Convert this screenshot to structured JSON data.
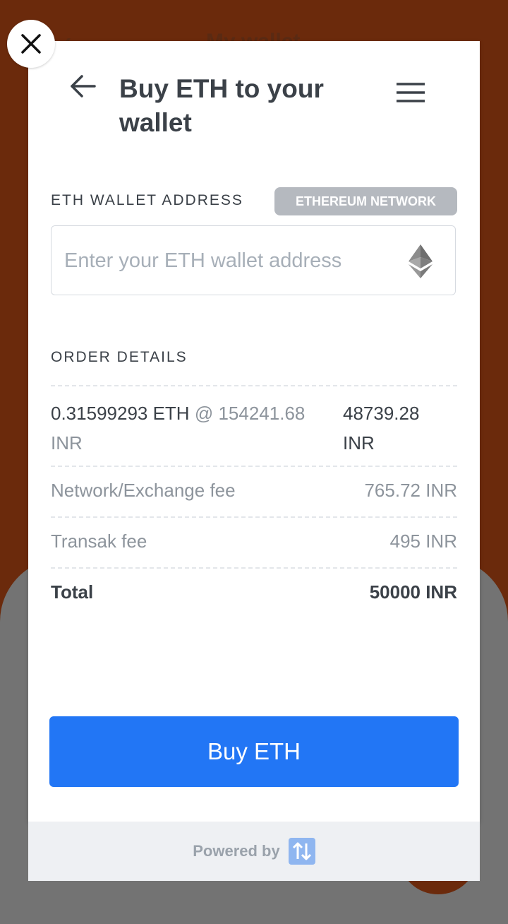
{
  "background": {
    "back_glyph": "‹",
    "title": "My wallet"
  },
  "close_button": {
    "icon": "close-icon"
  },
  "modal": {
    "title": "Buy ETH to your wallet",
    "back_icon": "arrow-left-icon",
    "menu_icon": "hamburger-menu-icon"
  },
  "wallet": {
    "label": "ETH WALLET ADDRESS",
    "network_badge": "ETHEREUM NETWORK",
    "placeholder": "Enter your ETH wallet address",
    "value": "",
    "icon": "ethereum-icon"
  },
  "order": {
    "label": "ORDER DETAILS",
    "amount": "0.31599293 ETH",
    "rate_prefix": "@",
    "rate": "154241.68",
    "rate_currency": "INR",
    "amount_value": "48739.28",
    "amount_currency": "INR",
    "rows": [
      {
        "label": "Network/Exchange fee",
        "value": "765.72 INR"
      },
      {
        "label": "Transak fee",
        "value": "495 INR"
      }
    ],
    "total_label": "Total",
    "total_value": "50000 INR"
  },
  "buy_button": {
    "label": "Buy ETH"
  },
  "footer": {
    "powered_by": "Powered by",
    "logo_icon": "transak-logo-icon"
  },
  "colors": {
    "accent": "#2276f5",
    "background": "#6b2a0c",
    "overlay_gray": "#737373",
    "text_dark": "#3b4148",
    "text_muted": "#8d949c"
  }
}
